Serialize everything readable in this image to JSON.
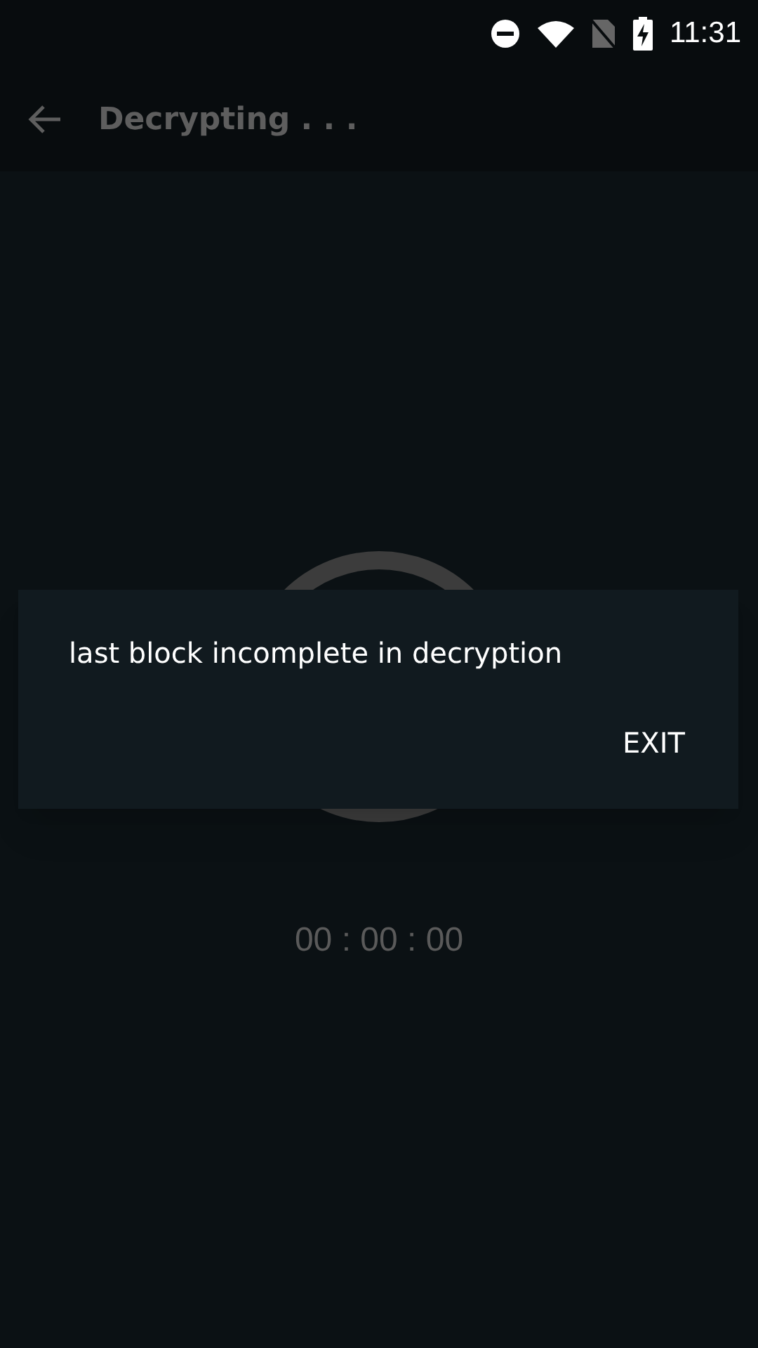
{
  "status_bar": {
    "time": "11:31"
  },
  "app_bar": {
    "title": "Decrypting . . ."
  },
  "timer": "00 : 00 : 00",
  "dialog": {
    "message": "last block incomplete in decryption",
    "buttons": [
      "EXIT"
    ]
  }
}
